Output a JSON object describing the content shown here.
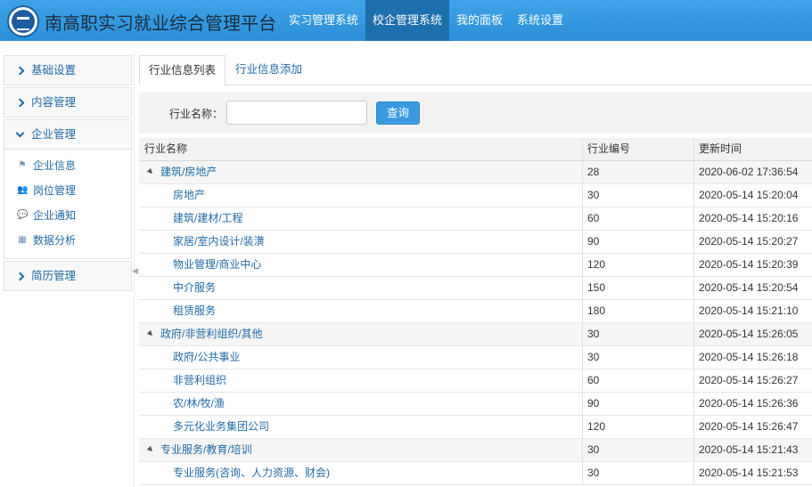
{
  "header": {
    "app_title": "南高职实习就业综合管理平台",
    "nav": [
      {
        "label": "实习管理系统",
        "active": false
      },
      {
        "label": "校企管理系统",
        "active": true
      },
      {
        "label": "我的面板",
        "active": false
      },
      {
        "label": "系统设置",
        "active": false
      }
    ],
    "colors": {
      "bar": "#3ea3e8",
      "active": "#1e6fae"
    }
  },
  "sidebar": {
    "groups": [
      {
        "label": "基础设置",
        "expanded": false
      },
      {
        "label": "内容管理",
        "expanded": false
      },
      {
        "label": "企业管理",
        "expanded": true,
        "items": [
          {
            "label": "企业信息",
            "icon": "flag-icon"
          },
          {
            "label": "岗位管理",
            "icon": "users-icon"
          },
          {
            "label": "企业通知",
            "icon": "chat-icon"
          },
          {
            "label": "数据分析",
            "icon": "grid-icon"
          }
        ]
      },
      {
        "label": "简历管理",
        "expanded": false
      }
    ]
  },
  "tabs": [
    {
      "label": "行业信息列表",
      "active": true
    },
    {
      "label": "行业信息添加",
      "active": false
    }
  ],
  "search": {
    "label": "行业名称：",
    "value": "",
    "button": "查询"
  },
  "table": {
    "headers": [
      "行业名称",
      "行业编号",
      "更新时间"
    ],
    "rows": [
      {
        "name": "建筑/房地产",
        "code": "28",
        "time": "2020-06-02 17:36:54",
        "parent": true
      },
      {
        "name": "房地产",
        "code": "30",
        "time": "2020-05-14 15:20:04",
        "parent": false
      },
      {
        "name": "建筑/建材/工程",
        "code": "60",
        "time": "2020-05-14 15:20:16",
        "parent": false
      },
      {
        "name": "家居/室内设计/装潢",
        "code": "90",
        "time": "2020-05-14 15:20:27",
        "parent": false
      },
      {
        "name": "物业管理/商业中心",
        "code": "120",
        "time": "2020-05-14 15:20:39",
        "parent": false
      },
      {
        "name": "中介服务",
        "code": "150",
        "time": "2020-05-14 15:20:54",
        "parent": false
      },
      {
        "name": "租赁服务",
        "code": "180",
        "time": "2020-05-14 15:21:10",
        "parent": false
      },
      {
        "name": "政府/非营利组织/其他",
        "code": "30",
        "time": "2020-05-14 15:26:05",
        "parent": true
      },
      {
        "name": "政府/公共事业",
        "code": "30",
        "time": "2020-05-14 15:26:18",
        "parent": false
      },
      {
        "name": "非营利组织",
        "code": "60",
        "time": "2020-05-14 15:26:27",
        "parent": false
      },
      {
        "name": "农/林/牧/渔",
        "code": "90",
        "time": "2020-05-14 15:26:36",
        "parent": false
      },
      {
        "name": "多元化业务集团公司",
        "code": "120",
        "time": "2020-05-14 15:26:47",
        "parent": false
      },
      {
        "name": "专业服务/教育/培训",
        "code": "30",
        "time": "2020-05-14 15:21:43",
        "parent": true
      },
      {
        "name": "专业服务(咨询、人力资源、财会)",
        "code": "30",
        "time": "2020-05-14 15:21:53",
        "parent": false
      }
    ]
  }
}
